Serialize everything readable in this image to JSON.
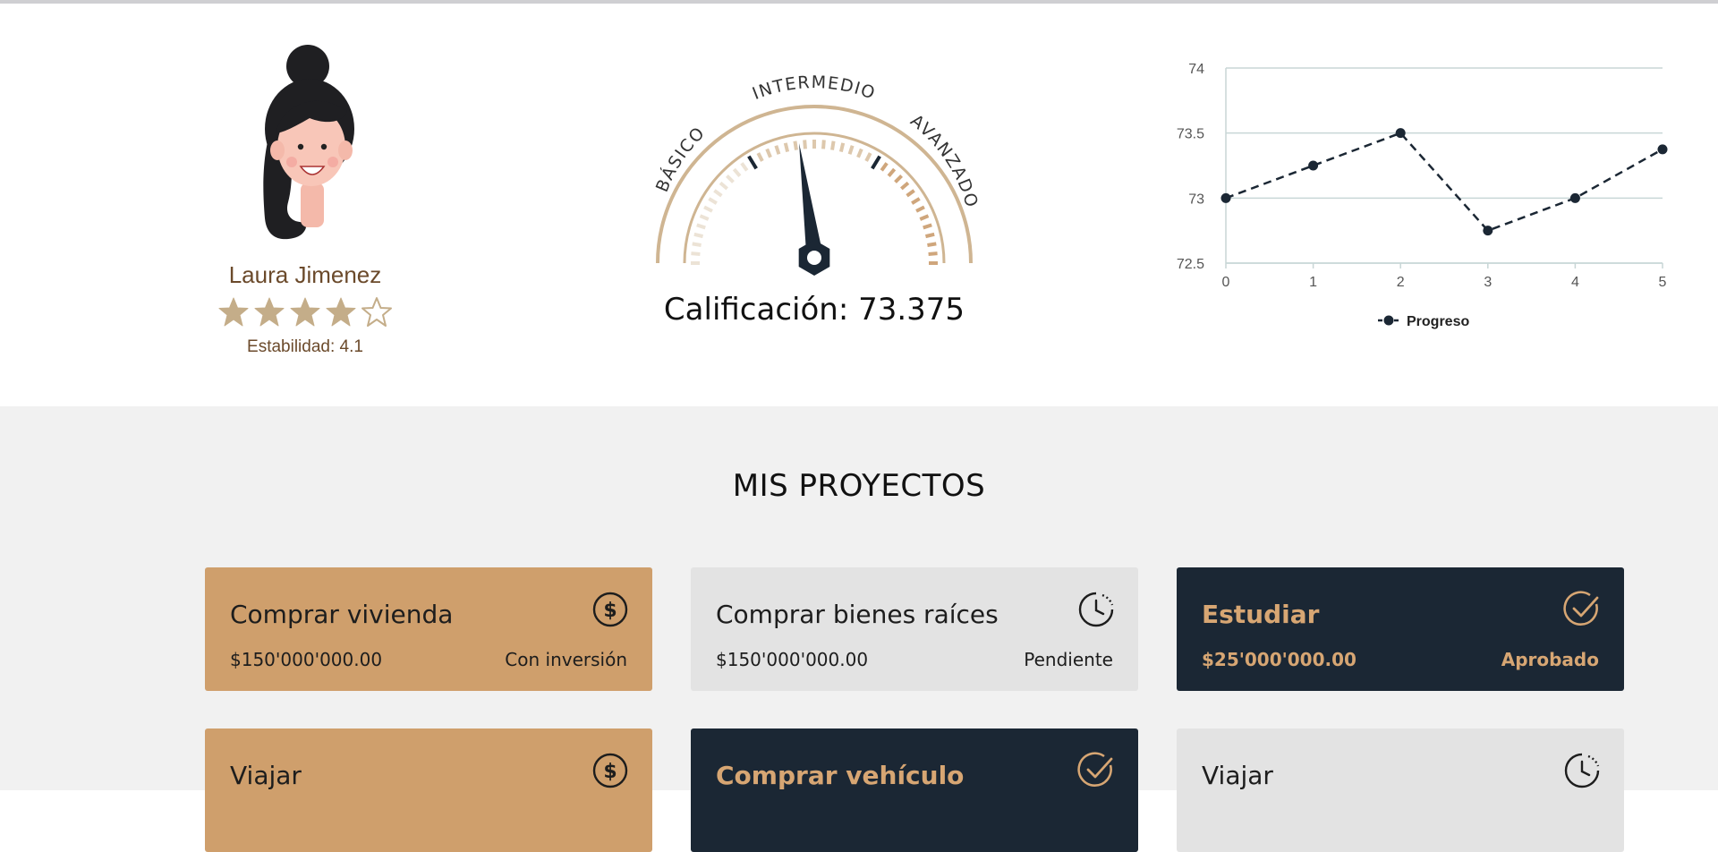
{
  "profile": {
    "name": "Laura Jimenez",
    "rating": 4,
    "rating_max": 5,
    "stability_label": "Estabilidad:",
    "stability_value": "4.1"
  },
  "gauge": {
    "labels": {
      "left": "BÁSICO",
      "top": "INTERMEDIO",
      "right": "AVANZADO"
    },
    "score_label": "Calificación:",
    "score_value": "73.375",
    "needle_fraction": 0.46
  },
  "chart_data": {
    "type": "line",
    "x": [
      0,
      1,
      2,
      3,
      4,
      5
    ],
    "series": [
      {
        "name": "Progreso",
        "values": [
          73.0,
          73.25,
          73.5,
          72.75,
          73.0,
          73.375
        ]
      }
    ],
    "ylim": [
      72.5,
      74
    ],
    "yticks": [
      72.5,
      73,
      73.5,
      74
    ],
    "xticks": [
      0,
      1,
      2,
      3,
      4,
      5
    ],
    "grid": true,
    "line_style": "dashed",
    "legend": "bottom-center"
  },
  "projects": {
    "title": "MIS PROYECTOS",
    "items": [
      {
        "title": "Comprar vivienda",
        "amount": "$150'000'000.00",
        "status": "Con inversión",
        "kind": "invest",
        "icon": "dollar-icon"
      },
      {
        "title": "Comprar bienes raíces",
        "amount": "$150'000'000.00",
        "status": "Pendiente",
        "kind": "pending",
        "icon": "clock-icon"
      },
      {
        "title": "Estudiar",
        "amount": "$25'000'000.00",
        "status": "Aprobado",
        "kind": "approved",
        "icon": "check-icon"
      },
      {
        "title": "Viajar",
        "kind": "invest",
        "icon": "dollar-icon"
      },
      {
        "title": "Comprar vehículo",
        "kind": "approved",
        "icon": "check-icon"
      },
      {
        "title": "Viajar",
        "kind": "pending",
        "icon": "clock-icon"
      }
    ]
  },
  "colors": {
    "gold": "#cf9f6c",
    "navy": "#1b2734",
    "light_gray": "#e3e3e3",
    "brown_text": "#6b4a2b",
    "star": "#c4ad89"
  }
}
